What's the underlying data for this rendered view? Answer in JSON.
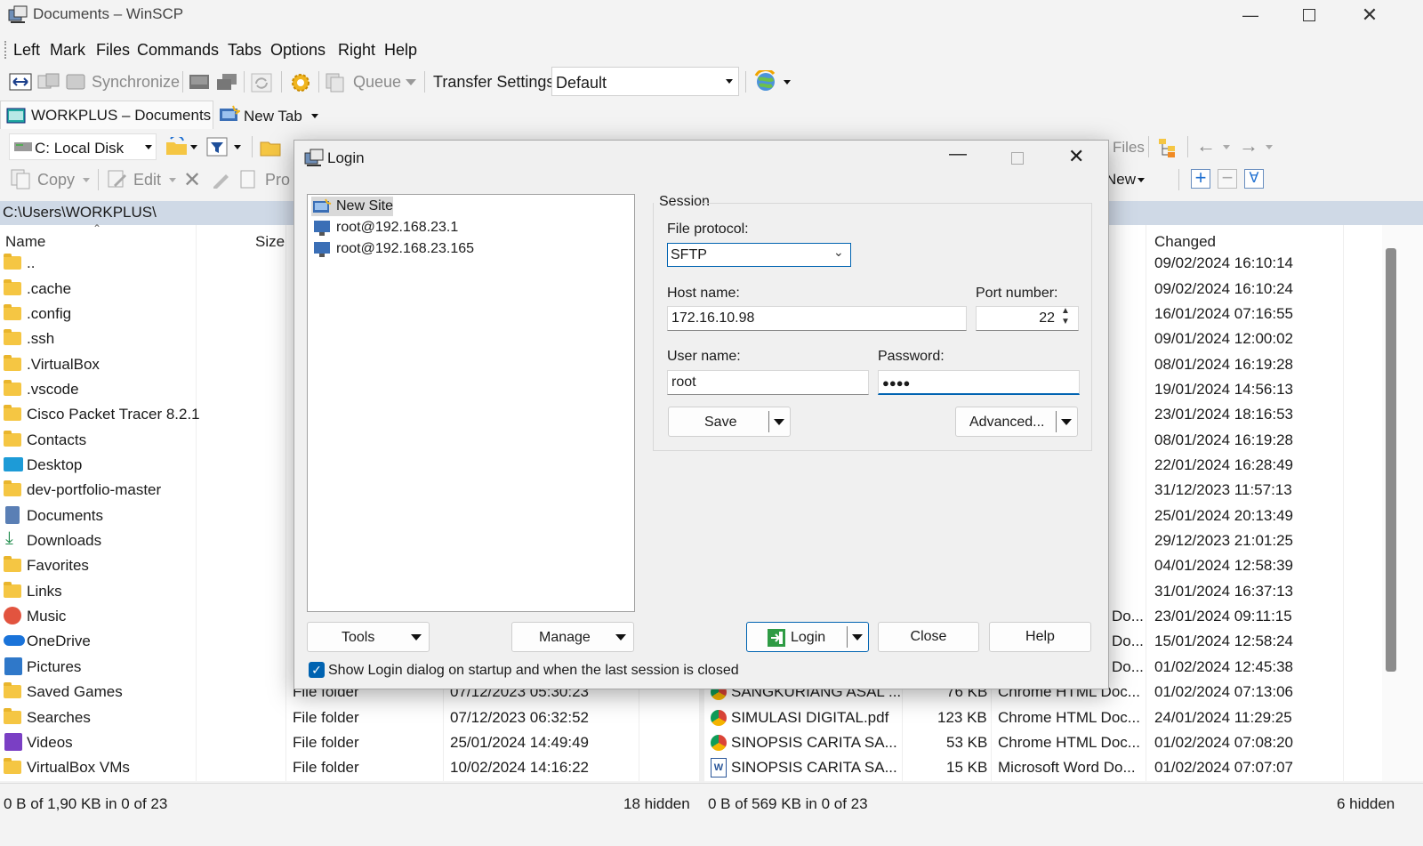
{
  "window": {
    "title": "Documents – WinSCP"
  },
  "menu": [
    "Left",
    "Mark",
    "Files",
    "Commands",
    "Tabs",
    "Options",
    "Right",
    "Help"
  ],
  "toolbar": {
    "synchronize": "Synchronize",
    "queue": "Queue",
    "transfer_settings_label": "Transfer Settings",
    "transfer_settings_value": "Default"
  },
  "tabs": {
    "session_tab": "WORKPLUS – Documents",
    "new_tab": "New Tab"
  },
  "left": {
    "drive": "C: Local Disk",
    "copy": "Copy",
    "edit": "Edit",
    "properties": "Pro",
    "path": "C:\\Users\\WORKPLUS\\",
    "columns": {
      "name": "Name",
      "size": "Size"
    },
    "files": [
      {
        "name": "..",
        "type": "",
        "changed": ""
      },
      {
        "name": ".cache"
      },
      {
        "name": ".config"
      },
      {
        "name": ".ssh"
      },
      {
        "name": ".VirtualBox"
      },
      {
        "name": ".vscode"
      },
      {
        "name": "Cisco Packet Tracer 8.2.1"
      },
      {
        "name": "Contacts"
      },
      {
        "name": "Desktop"
      },
      {
        "name": "dev-portfolio-master"
      },
      {
        "name": "Documents"
      },
      {
        "name": "Downloads"
      },
      {
        "name": "Favorites"
      },
      {
        "name": "Links"
      },
      {
        "name": "Music"
      },
      {
        "name": "OneDrive"
      },
      {
        "name": "Pictures"
      },
      {
        "name": "Saved Games",
        "type": "File folder",
        "changed": "07/12/2023 05:30:23"
      },
      {
        "name": "Searches",
        "type": "File folder",
        "changed": "07/12/2023 06:32:52"
      },
      {
        "name": "Videos",
        "type": "File folder",
        "changed": "25/01/2024 14:49:49"
      },
      {
        "name": "VirtualBox VMs",
        "type": "File folder",
        "changed": "10/02/2024 14:16:22"
      }
    ],
    "status": "0 B of 1,90 KB in 0 of 23",
    "hidden": "18 hidden"
  },
  "right": {
    "files_label": "Files",
    "new_label": "New",
    "columns": {
      "changed": "Changed"
    },
    "changed": [
      "09/02/2024 16:10:14",
      "09/02/2024 16:10:24",
      "16/01/2024 07:16:55",
      "09/01/2024 12:00:02",
      "08/01/2024 16:19:28",
      "19/01/2024 14:56:13",
      "23/01/2024 18:16:53",
      "08/01/2024 16:19:28",
      "22/01/2024 16:28:49",
      "31/12/2023 11:57:13",
      "25/01/2024 20:13:49",
      "29/12/2023 21:01:25",
      "04/01/2024 12:58:39",
      "31/01/2024 16:37:13",
      "23/01/2024 09:11:15",
      "15/01/2024 12:58:24",
      "01/02/2024 12:45:38",
      "01/02/2024 07:13:06",
      "24/01/2024 11:29:25",
      "01/02/2024 07:08:20",
      "01/02/2024 07:07:07"
    ],
    "type_partial": [
      "Do...",
      "Do...",
      "Do..."
    ],
    "bottom_files": [
      {
        "name": "SANGKURIANG ASAL ...",
        "size": "76 KB",
        "type": "Chrome HTML Doc..."
      },
      {
        "name": "SIMULASI DIGITAL.pdf",
        "size": "123 KB",
        "type": "Chrome HTML Doc..."
      },
      {
        "name": "SINOPSIS CARITA SA...",
        "size": "53 KB",
        "type": "Chrome HTML Doc..."
      },
      {
        "name": "SINOPSIS CARITA SA...",
        "size": "15 KB",
        "type": "Microsoft Word Do..."
      }
    ],
    "status": "0 B of 569 KB in 0 of 23",
    "hidden": "6 hidden"
  },
  "dialog": {
    "title": "Login",
    "sites": [
      "New Site",
      "root@192.168.23.1",
      "root@192.168.23.165"
    ],
    "session_group": "Session",
    "file_protocol_label": "File protocol:",
    "file_protocol": "SFTP",
    "host_label": "Host name:",
    "host": "172.16.10.98",
    "port_label": "Port number:",
    "port": "22",
    "user_label": "User name:",
    "user": "root",
    "password_label": "Password:",
    "password": "●●●●",
    "save": "Save",
    "advanced": "Advanced...",
    "tools": "Tools",
    "manage": "Manage",
    "login": "Login",
    "close": "Close",
    "help": "Help",
    "startup_checkbox": "Show Login dialog on startup and when the last session is closed"
  }
}
